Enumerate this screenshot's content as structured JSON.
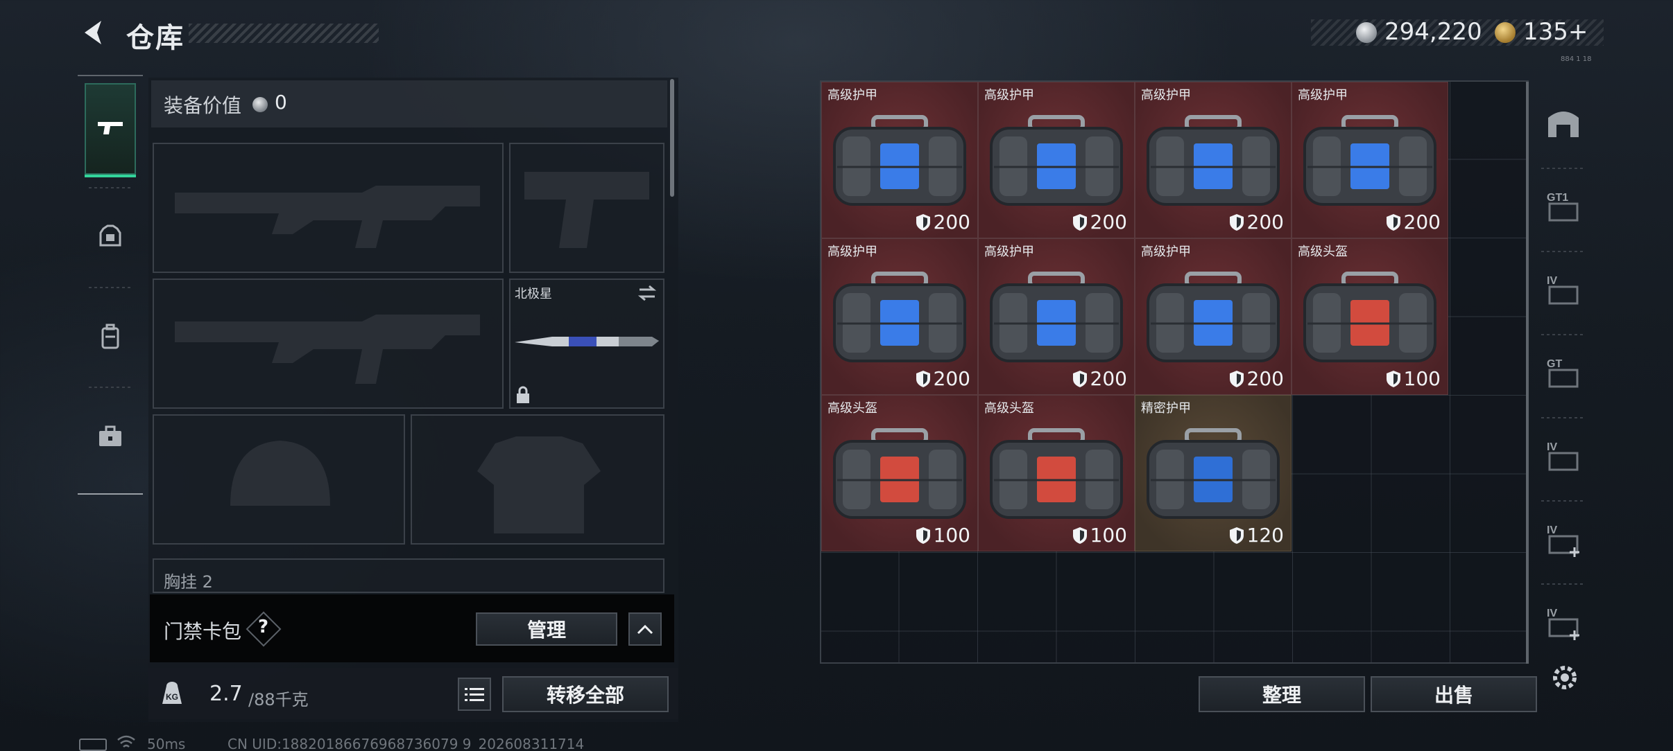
{
  "header": {
    "title": "仓库",
    "silver_amount": "294,220",
    "gold_amount": "135+",
    "tiny_text": "884 1 18"
  },
  "equipment": {
    "value_label": "装备价值",
    "value": "0",
    "melee_name": "北极星",
    "chest_label": "胸挂 2"
  },
  "card_pack": {
    "label": "门禁卡包",
    "help": "?",
    "manage_label": "管理",
    "collapse_icon": "chevron-up-icon"
  },
  "capacity": {
    "current": "2.7",
    "max": "/88千克",
    "kg_icon_text": "KG",
    "transfer_label": "转移全部"
  },
  "storage": {
    "items": [
      {
        "name": "高级护甲",
        "durability": "200",
        "rarity": "red",
        "bag_color": "#3a7ce8"
      },
      {
        "name": "高级护甲",
        "durability": "200",
        "rarity": "red",
        "bag_color": "#3a7ce8"
      },
      {
        "name": "高级护甲",
        "durability": "200",
        "rarity": "red",
        "bag_color": "#3a7ce8"
      },
      {
        "name": "高级护甲",
        "durability": "200",
        "rarity": "red",
        "bag_color": "#3a7ce8"
      },
      {
        "name": "高级护甲",
        "durability": "200",
        "rarity": "red",
        "bag_color": "#3a7ce8"
      },
      {
        "name": "高级护甲",
        "durability": "200",
        "rarity": "red",
        "bag_color": "#3a7ce8"
      },
      {
        "name": "高级护甲",
        "durability": "200",
        "rarity": "red",
        "bag_color": "#3a7ce8"
      },
      {
        "name": "高级头盔",
        "durability": "100",
        "rarity": "red",
        "bag_color": "#d24b3e"
      },
      {
        "name": "高级头盔",
        "durability": "100",
        "rarity": "red",
        "bag_color": "#d24b3e"
      },
      {
        "name": "高级头盔",
        "durability": "100",
        "rarity": "red",
        "bag_color": "#d24b3e"
      },
      {
        "name": "精密护甲",
        "durability": "120",
        "rarity": "gold",
        "bag_color": "#2f6fd6"
      }
    ],
    "sort_label": "整理",
    "sell_label": "出售"
  },
  "right_rail": {
    "icons": [
      "storage-home-icon",
      "gt1-tab-icon",
      "iv-tab-icon",
      "gt-tab-icon",
      "iv-tab-icon",
      "iv-plus-tab-icon",
      "iv-plus-tab-icon"
    ],
    "labels": [
      "",
      "GT1",
      "IV",
      "GT",
      "IV",
      "IV",
      "IV"
    ]
  },
  "status_bar": {
    "ping": "50ms",
    "uid": "CN UID:18820186676968736079 9_202608311714"
  },
  "colors": {
    "accent_green": "#33d49a",
    "rarity_red": "#5b272b",
    "rarity_gold": "#4e4130"
  }
}
